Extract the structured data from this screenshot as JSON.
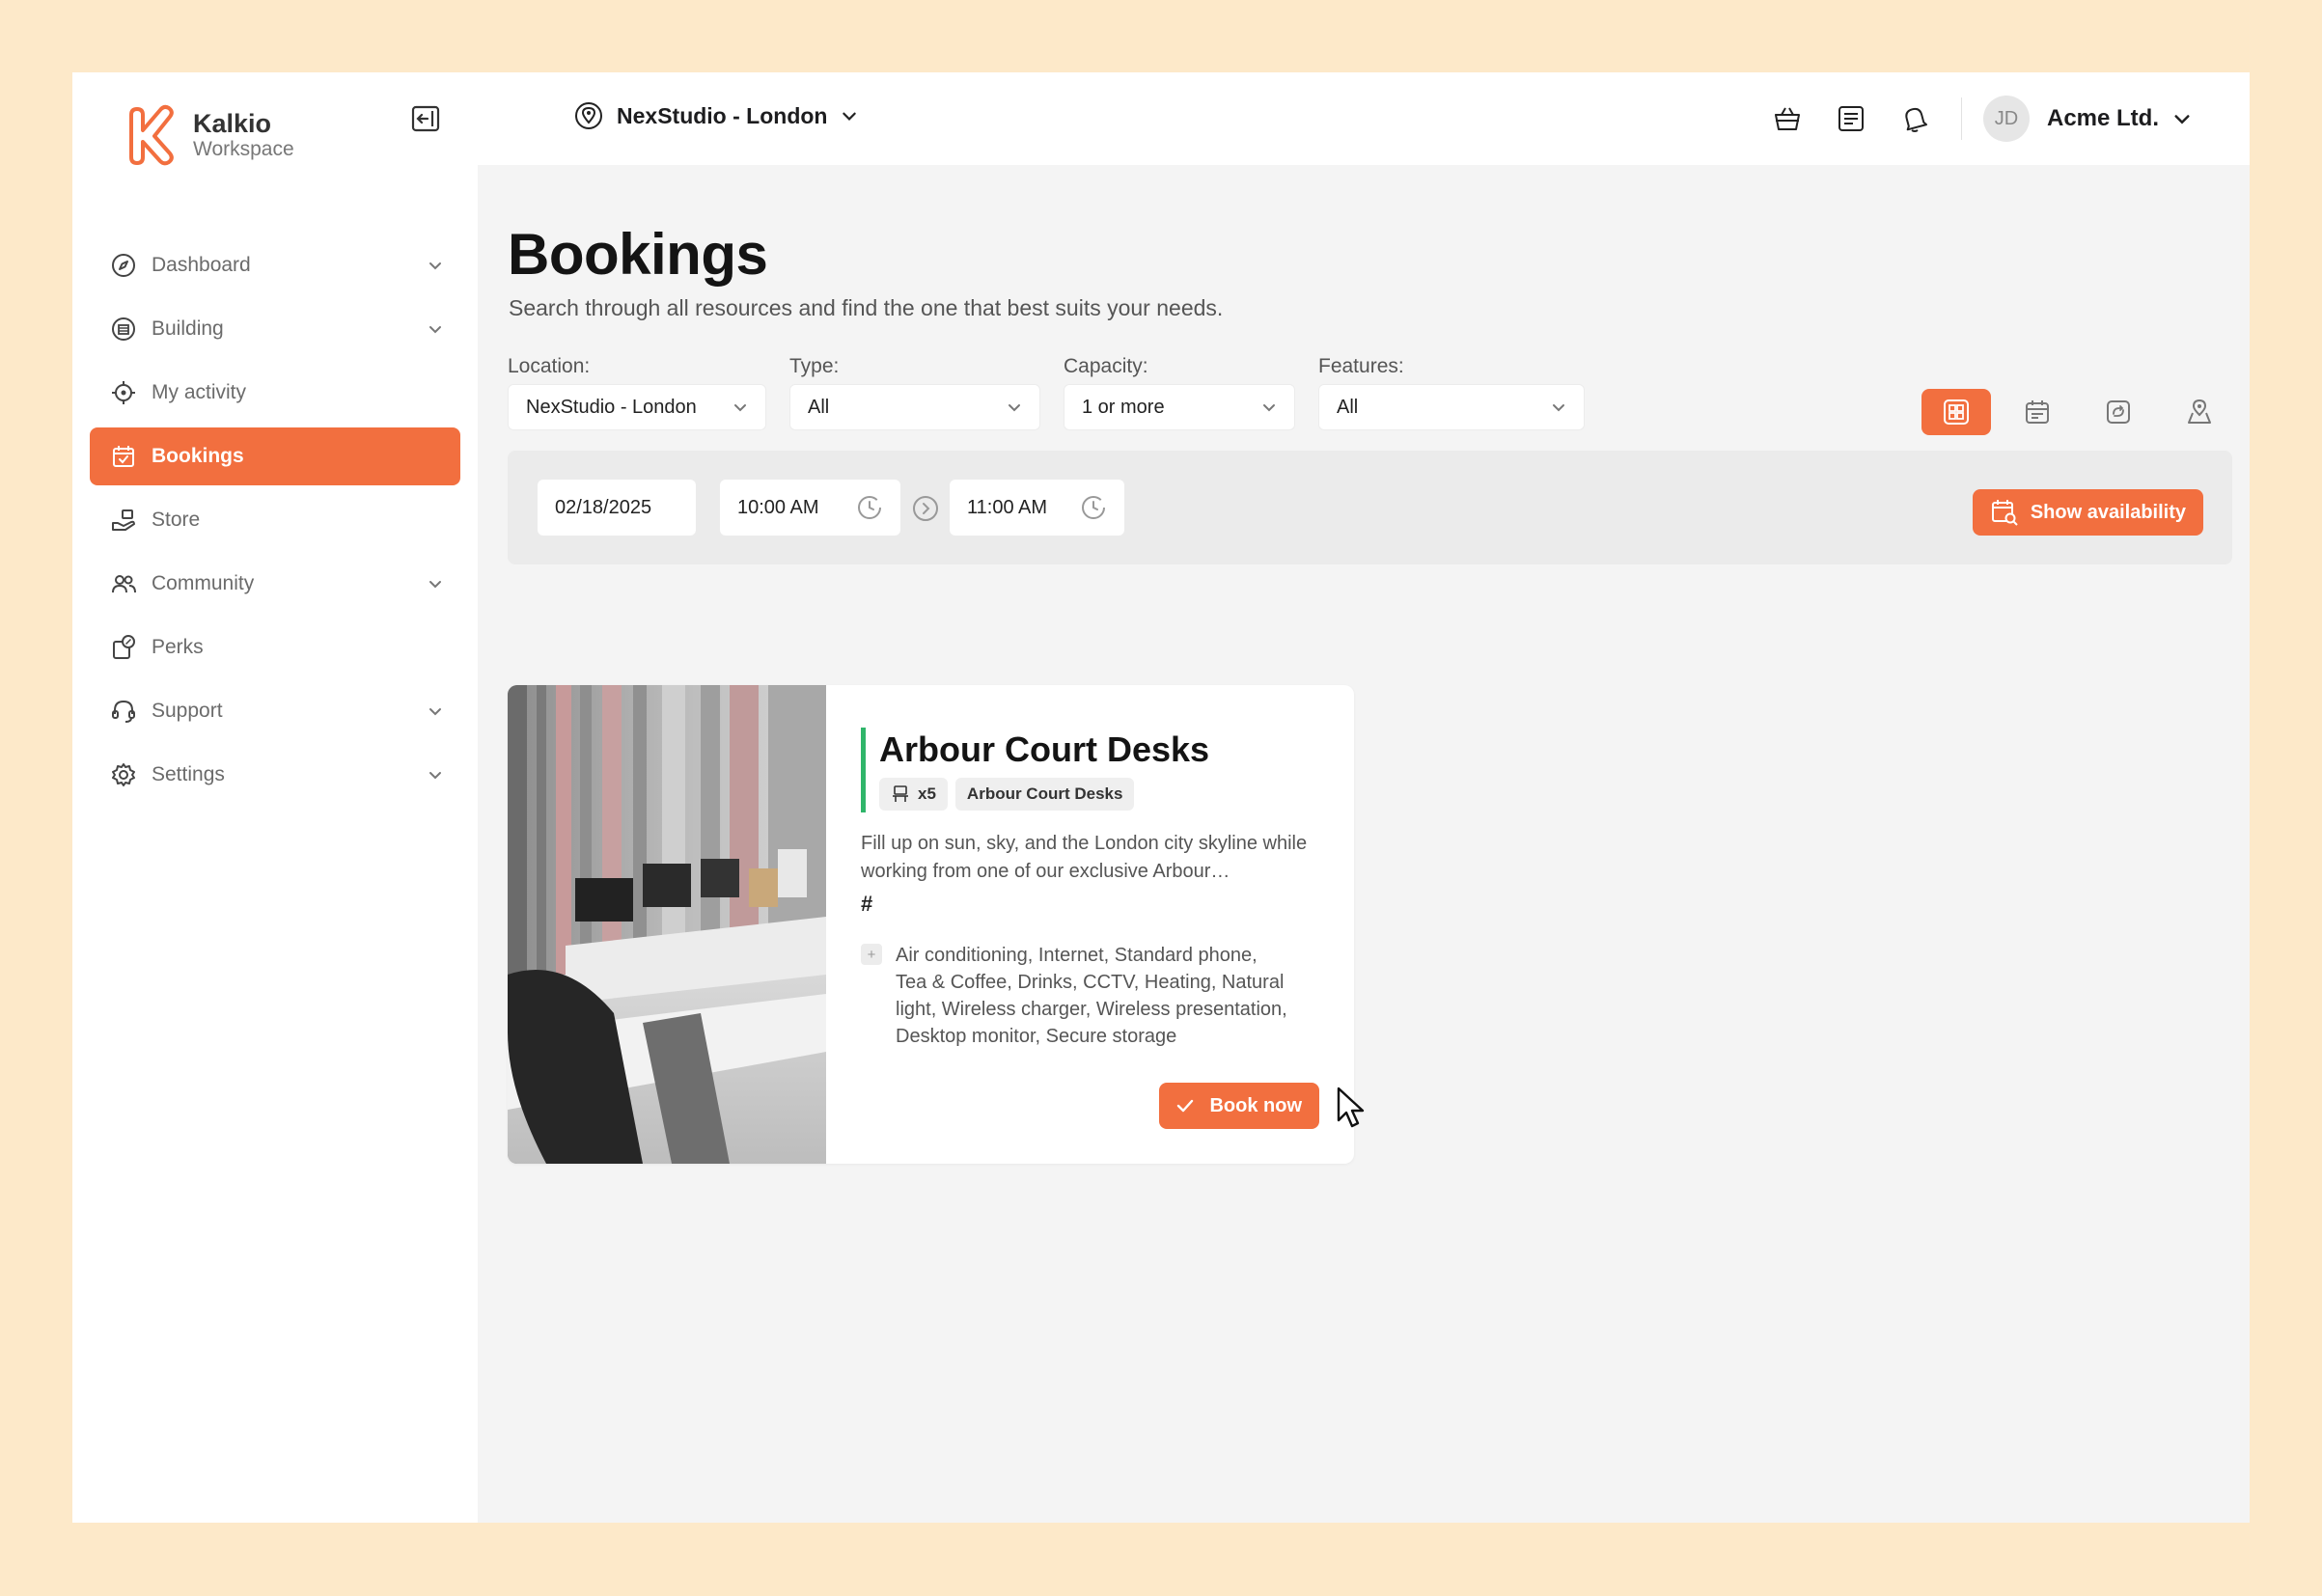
{
  "app": {
    "brand": "Kalkio",
    "brand_sub": "Workspace",
    "accent_color": "#f26f3f",
    "available_color": "#2fb56a"
  },
  "topbar": {
    "location": "NexStudio - London",
    "user_initials": "JD",
    "account": "Acme Ltd.",
    "icons": [
      "basket-icon",
      "orders-icon",
      "bell-icon"
    ]
  },
  "sidebar": {
    "items": [
      {
        "label": "Dashboard",
        "icon": "compass-icon",
        "has_children": true
      },
      {
        "label": "Building",
        "icon": "building-icon",
        "has_children": true
      },
      {
        "label": "My activity",
        "icon": "crosshair-icon",
        "has_children": false
      },
      {
        "label": "Bookings",
        "icon": "calendar-check-icon",
        "has_children": false,
        "active": true
      },
      {
        "label": "Store",
        "icon": "store-hand-icon",
        "has_children": false
      },
      {
        "label": "Community",
        "icon": "people-icon",
        "has_children": true
      },
      {
        "label": "Perks",
        "icon": "perks-icon",
        "has_children": false
      },
      {
        "label": "Support",
        "icon": "headset-icon",
        "has_children": true
      },
      {
        "label": "Settings",
        "icon": "gear-icon",
        "has_children": true
      }
    ]
  },
  "page": {
    "title": "Bookings",
    "subtitle": "Search through all resources and find the one that best suits your needs."
  },
  "filters": {
    "location": {
      "label": "Location:",
      "value": "NexStudio - London"
    },
    "type": {
      "label": "Type:",
      "value": "All"
    },
    "capacity": {
      "label": "Capacity:",
      "value": "1 or more"
    },
    "features": {
      "label": "Features:",
      "value": "All"
    }
  },
  "views": [
    "grid-view-icon",
    "calendar-view-icon",
    "timeline-view-icon",
    "map-view-icon"
  ],
  "timebar": {
    "date": "02/18/2025",
    "start_time": "10:00 AM",
    "end_time": "11:00 AM",
    "availability_button": "Show availability"
  },
  "resource_card": {
    "title": "Arbour Court Desks",
    "capacity": "x5",
    "tag": "Arbour Court Desks",
    "description": "Fill up on sun, sky, and the London city skyline while working from one of our exclusive Arbour…",
    "hash": "#",
    "features_expand": "+",
    "features": "Air conditioning, Internet, Standard phone, Tea & Coffee, Drinks, CCTV, Heating, Natural light, Wireless charger, Wireless presentation, Desktop monitor, Secure storage",
    "book_button": "Book now"
  }
}
